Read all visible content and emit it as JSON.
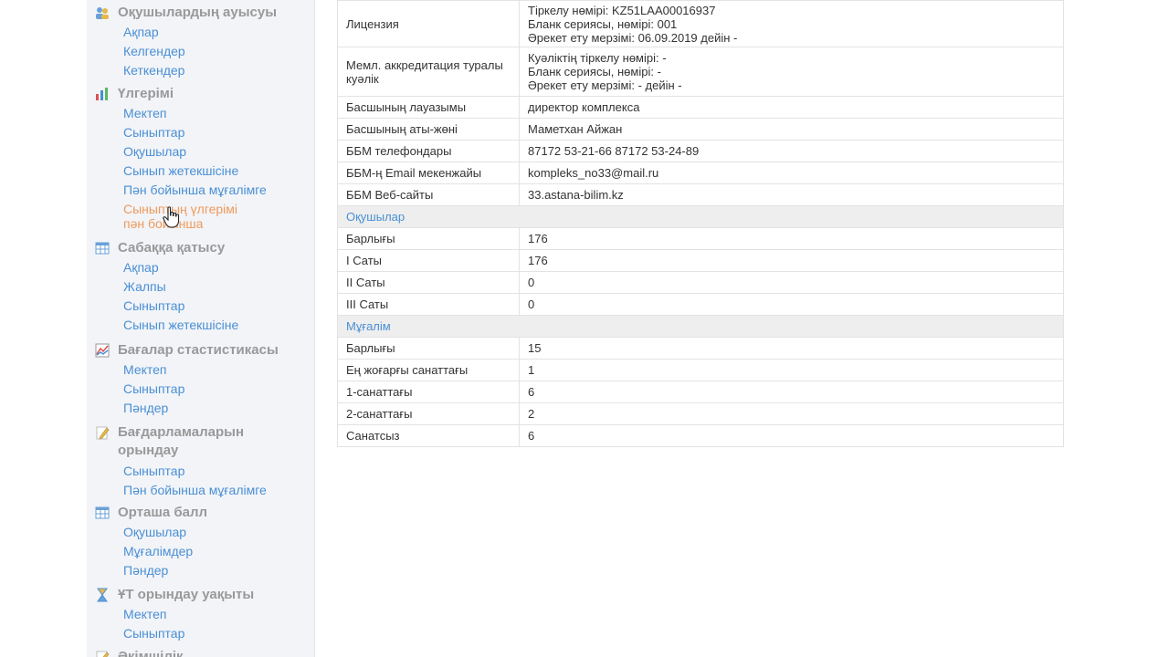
{
  "sidebar": {
    "sections": [
      {
        "title": "Оқушылардың ауысуы",
        "icon": "users-swap-icon",
        "items": [
          "Ақпар",
          "Келгендер",
          "Кеткендер"
        ]
      },
      {
        "title": "Үлгерімі",
        "icon": "bar-chart-icon",
        "items": [
          "Мектеп",
          "Сыныптар",
          "Оқушылар",
          "Сынып жетекшісіне",
          "Пән бойынша мұғалімге"
        ],
        "active_item": "Сыныптың үлгерімі пән бойынша",
        "active_item_lines": [
          "Сыныптың үлгерімі",
          "пән бойынша"
        ]
      },
      {
        "title": "Сабаққа қатысу",
        "icon": "table-icon",
        "items": [
          "Ақпар",
          "Жалпы",
          "Сыныптар",
          "Сынып жетекшісіне"
        ]
      },
      {
        "title": "Бағалар стастистикасы",
        "icon": "statistics-chart-icon",
        "items": [
          "Мектеп",
          "Сыныптар",
          "Пәндер"
        ]
      },
      {
        "title_lines": [
          "Бағдарламаларын",
          "орындау"
        ],
        "icon": "edit-icon",
        "items": [
          "Сыныптар",
          "Пән бойынша мұғалімге"
        ]
      },
      {
        "title": "Орташа балл",
        "icon": "table-icon",
        "items": [
          "Оқушылар",
          "Мұғалімдер",
          "Пәндер"
        ]
      },
      {
        "title": "ҰТ орындау уақыты",
        "icon": "hourglass-icon",
        "items": [
          "Мектеп",
          "Сыныптар"
        ]
      },
      {
        "title": "Әкімшілік",
        "icon": "edit-icon",
        "items": []
      }
    ]
  },
  "info_table": {
    "license": {
      "label": "Лицензия",
      "lines": [
        "Тіркелу нөмірі: KZ51LAA00016937",
        "Бланк сериясы, нөмірі: 001",
        "Әрекет ету мерзімі: 06.09.2019 дейін -"
      ]
    },
    "accreditation": {
      "label": "Мемл. аккредитация туралы куәлік",
      "lines": [
        "Куәліктің тіркелу нөмірі: -",
        "Бланк сериясы, нөмірі: -",
        "Әрекет ету мерзімі: - дейін -"
      ]
    },
    "rows": [
      {
        "label": "Басшының лауазымы",
        "value": "директор комплекса"
      },
      {
        "label": "Басшының аты-жөні",
        "value": "Маметхан Айжан"
      },
      {
        "label": "ББМ телефондары",
        "value": "87172 53-21-66 87172 53-24-89"
      },
      {
        "label": "ББМ-ң Email мекенжайы",
        "value": "kompleks_no33@mail.ru"
      },
      {
        "label": "ББМ Веб-сайты",
        "value": "33.astana-bilim.kz"
      }
    ],
    "students_header": "Оқушылар",
    "students": [
      {
        "label": "Барлығы",
        "value": "176"
      },
      {
        "label": "I Саты",
        "value": "176"
      },
      {
        "label": "II Саты",
        "value": "0"
      },
      {
        "label": "III Саты",
        "value": "0"
      }
    ],
    "teachers_header": "Мұғалім",
    "teachers": [
      {
        "label": "Барлығы",
        "value": "15"
      },
      {
        "label": "Ең жоғарғы санаттағы",
        "value": "1"
      },
      {
        "label": "1-санаттағы",
        "value": "6"
      },
      {
        "label": "2-санаттағы",
        "value": "2"
      },
      {
        "label": "Санатсыз",
        "value": "6"
      }
    ]
  },
  "colors": {
    "link": "#4a8fd4",
    "active": "#ef9a5a",
    "heading": "#999999",
    "sidebar_bg": "#f2f4f8",
    "subheader_bg": "#eeeeee"
  }
}
